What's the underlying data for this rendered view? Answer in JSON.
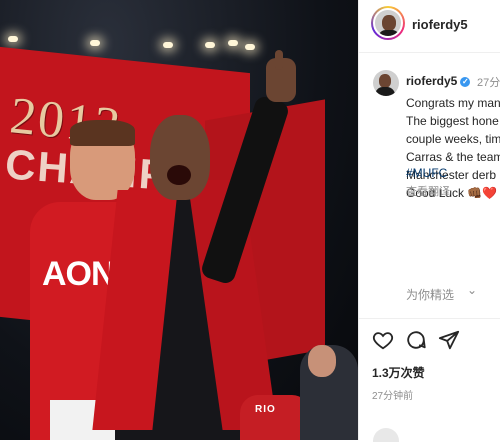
{
  "photo": {
    "flag_year": "2013",
    "flag_word": "CHAMPIONS",
    "sponsor": "AON",
    "jersey_text": "RIO"
  },
  "header": {
    "username": "rioferdy5"
  },
  "caption": {
    "username": "rioferdy5",
    "verified_icon": "verified-badge-icon",
    "time": "27分",
    "lines": [
      "Congrats my man",
      "The biggest hone",
      "couple weeks, tim",
      "Carras & the team",
      "Manchester derb",
      "Good Luck 👊🏾❤️"
    ],
    "hashtag": "#MUFC",
    "translate": "查看翻译",
    "selected": "为你精选",
    "selected_chevron": "⌄"
  },
  "actions": {
    "like_icon": "heart-icon",
    "comment_icon": "comment-icon",
    "share_icon": "share-icon",
    "likes": "1.3万次赞",
    "time": "27分钟前"
  },
  "colors": {
    "verified": "#3897f0",
    "hashtag": "#003569",
    "text": "#262626",
    "muted": "#8e8e8e"
  }
}
